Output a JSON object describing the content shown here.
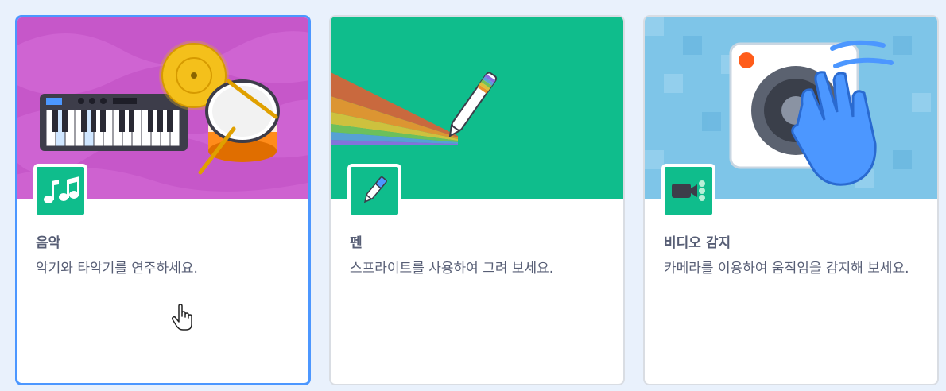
{
  "extensions": [
    {
      "title": "음악",
      "description": "악기와 타악기를 연주하세요.",
      "icon": "music-notes-icon",
      "image": "keyboard-drum-cymbal-illustration",
      "background_color": "#c657c9",
      "selected": true
    },
    {
      "title": "펜",
      "description": "스프라이트를 사용하여 그려 보세요.",
      "icon": "pen-icon",
      "image": "pen-rainbow-illustration",
      "background_color": "#0fbd8c",
      "selected": false
    },
    {
      "title": "비디오 감지",
      "description": "카메라를 이용하여 움직임을 감지해 보세요.",
      "icon": "video-camera-icon",
      "image": "camera-hand-wave-illustration",
      "background_color": "#7ec5e8",
      "selected": false
    }
  ],
  "colors": {
    "badge": "#0fbd8c",
    "selected_border": "#4c97ff",
    "text": "#575e75",
    "page_background": "#e9f1fc"
  }
}
